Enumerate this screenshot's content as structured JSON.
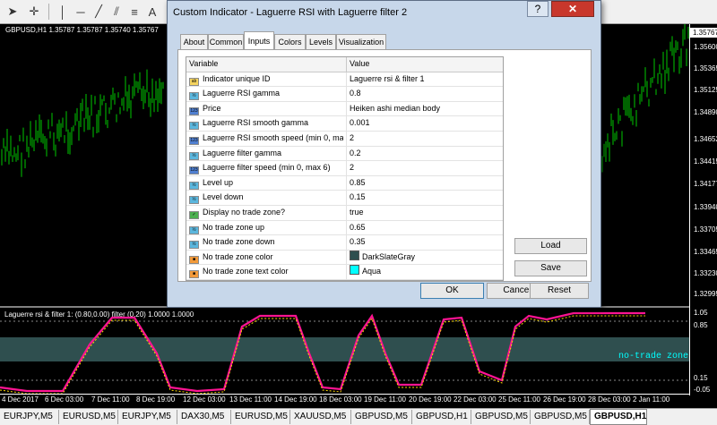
{
  "window": {
    "title": "Custom Indicator - Laguerre RSI with Laguerre filter 2"
  },
  "dialog": {
    "help_label": "?",
    "close_label": "✕",
    "tabs": [
      "About",
      "Common",
      "Inputs",
      "Colors",
      "Levels",
      "Visualization"
    ],
    "active_tab": "Inputs",
    "columns": [
      "Variable",
      "Value"
    ],
    "rows": [
      {
        "icon": "ab",
        "icon_color": "#f4d35e",
        "name": "Indicator unique ID",
        "value": "Laguerre rsi & filter 1"
      },
      {
        "icon": "½",
        "icon_color": "#5bb6dd",
        "name": "Laguerre RSI gamma",
        "value": "0.8"
      },
      {
        "icon": "123",
        "icon_color": "#4f7fd0",
        "name": "Price",
        "value": "Heiken ashi median body"
      },
      {
        "icon": "½",
        "icon_color": "#5bb6dd",
        "name": "Laguerre RSI smooth gamma",
        "value": "0.001"
      },
      {
        "icon": "123",
        "icon_color": "#4f7fd0",
        "name": "Laguerre RSI smooth speed (min 0, max 6)",
        "value": "2"
      },
      {
        "icon": "½",
        "icon_color": "#5bb6dd",
        "name": "Laguerre filter gamma",
        "value": "0.2"
      },
      {
        "icon": "123",
        "icon_color": "#4f7fd0",
        "name": "Laguerre filter speed (min 0, max 6)",
        "value": "2"
      },
      {
        "icon": "½",
        "icon_color": "#5bb6dd",
        "name": "Level up",
        "value": "0.85"
      },
      {
        "icon": "½",
        "icon_color": "#5bb6dd",
        "name": "Level down",
        "value": "0.15"
      },
      {
        "icon": "✓",
        "icon_color": "#4caf50",
        "name": "Display no trade zone?",
        "value": "true"
      },
      {
        "icon": "½",
        "icon_color": "#5bb6dd",
        "name": "No trade zone up",
        "value": "0.65"
      },
      {
        "icon": "½",
        "icon_color": "#5bb6dd",
        "name": "No trade zone down",
        "value": "0.35"
      },
      {
        "icon": "■",
        "icon_color": "#f29a3a",
        "name": "No trade zone color",
        "value": "DarkSlateGray",
        "swatch": "#2f4f4f"
      },
      {
        "icon": "■",
        "icon_color": "#f29a3a",
        "name": "No trade zone text color",
        "value": "Aqua",
        "swatch": "#00ffff"
      }
    ],
    "side_buttons": {
      "load": "Load",
      "save": "Save"
    },
    "buttons": {
      "ok": "OK",
      "cancel": "Cancel",
      "reset": "Reset"
    }
  },
  "chart": {
    "title": "GBPUSD,H1  1.35787 1.35787 1.35740 1.35767",
    "price_labels": [
      "1.35767",
      "1.35600",
      "1.35365",
      "1.35125",
      "1.34890",
      "1.34652",
      "1.34415",
      "1.34177",
      "1.33940",
      "1.33705",
      "1.33465",
      "1.33230",
      "1.32995"
    ],
    "current_price": "1.35767",
    "indicator_title": "Laguerre rsi & filter 1: (0.80,0.00) filter (0.20) 1.0000 1.0000",
    "indicator_levels": [
      "1.05",
      "0.85",
      "0.15",
      "-0.05"
    ],
    "no_trade_zone_text": "no-trade zone",
    "time_labels": [
      "4 Dec 2017",
      "6 Dec 03:00",
      "7 Dec 11:00",
      "8 Dec 19:00",
      "12 Dec 03:00",
      "13 Dec 11:00",
      "14 Dec 19:00",
      "18 Dec 03:00",
      "19 Dec 11:00",
      "20 Dec 19:00",
      "22 Dec 03:00",
      "25 Dec 11:00",
      "26 Dec 19:00",
      "28 Dec 03:00",
      "29 Dec 11:00",
      "2 Jan 11:00"
    ],
    "colors": {
      "candles": "#00c800",
      "rsi": "#ff1493",
      "filter": "#ffd700",
      "zone": "#2f4f4f",
      "zone_text": "#00ffff"
    }
  },
  "tabs": [
    "EURJPY,M5",
    "EURUSD,M5",
    "EURJPY,M5",
    "DAX30,M5",
    "EURUSD,M5",
    "XAUUSD,M5",
    "GBPUSD,M5",
    "GBPUSD,H1",
    "GBPUSD,M5",
    "GBPUSD,M5",
    "GBPUSD,H1"
  ],
  "active_tab": "GBPUSD,H1",
  "toolbar": {
    "icons": [
      "cursor-icon",
      "crosshair-icon",
      "vertical-line-icon",
      "horizontal-line-icon",
      "trendline-icon",
      "channel-icon",
      "fibo-icon",
      "text-icon",
      "label-icon"
    ]
  }
}
